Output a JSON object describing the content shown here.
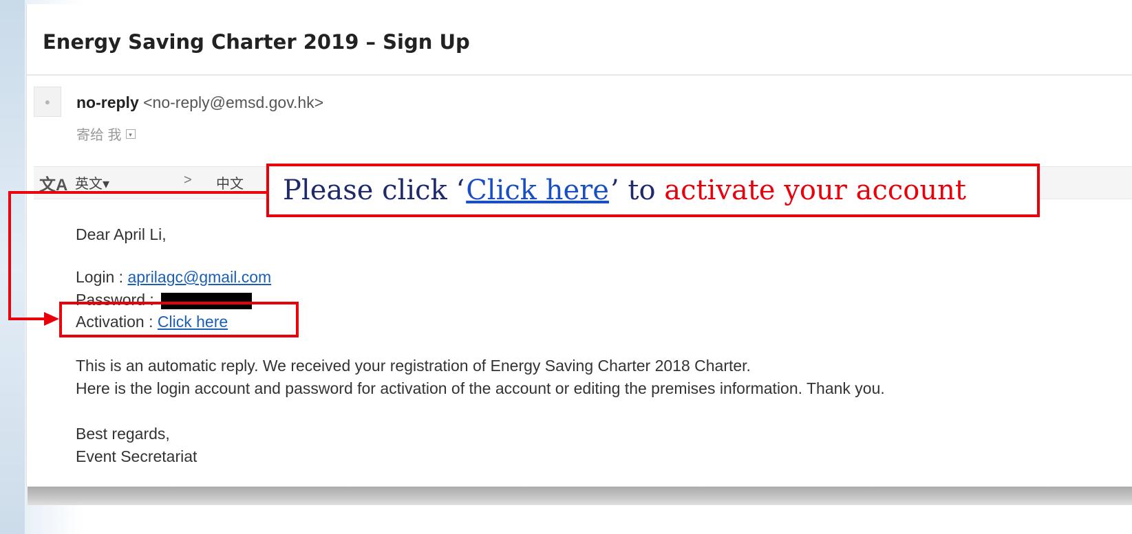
{
  "email": {
    "subject": "Energy Saving Charter 2019 – Sign Up",
    "sender_name": "no-reply",
    "sender_email": "<no-reply@emsd.gov.hk>",
    "recipient": "寄给 我",
    "translate": {
      "icon": "文A",
      "from_lang": "英文▾",
      "arrow": ">",
      "to_lang": "中文"
    },
    "greeting": "Dear April Li,",
    "login_label": "Login : ",
    "login_email": "aprilagc@gmail.com",
    "password_label": "Password : ",
    "activation_label": "Activation : ",
    "activation_link": "Click here",
    "body_line1": "This is an automatic reply. We received your registration of Energy Saving Charter 2018 Charter.",
    "body_line2": "Here is the login account and password for activation of the account or editing the premises information. Thank you.",
    "signoff": "Best regards,",
    "signature": "Event Secretariat"
  },
  "annotation": {
    "part1": "Please click ‘",
    "link_text": "Click here",
    "part2": "’ to ",
    "part3": "activate your account",
    "color": "#e8000b"
  }
}
